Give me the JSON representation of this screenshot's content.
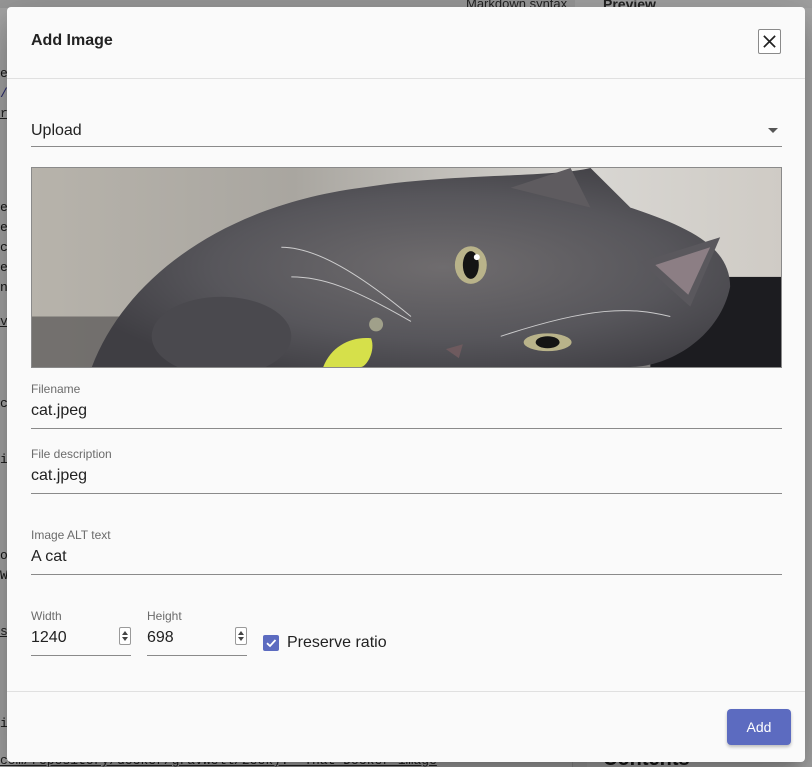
{
  "background": {
    "editor_syntax_label": "Markdown syntax",
    "preview_title": "Preview",
    "contents_heading": "Contents",
    "editor_line": "com/repository/docker/gravwell/zeek).  That Docker image"
  },
  "dialog": {
    "title": "Add Image",
    "close_icon": "close-icon",
    "source_select": {
      "value": "Upload",
      "options": [
        "Upload"
      ]
    },
    "image_preview": {
      "alt": "cat.jpeg"
    },
    "filename": {
      "label": "Filename",
      "value": "cat.jpeg"
    },
    "file_description": {
      "label": "File description",
      "value": "cat.jpeg"
    },
    "alt_text": {
      "label": "Image ALT text",
      "value": "A cat"
    },
    "width": {
      "label": "Width",
      "value": "1240"
    },
    "height": {
      "label": "Height",
      "value": "698"
    },
    "preserve_ratio": {
      "label": "Preserve ratio",
      "checked": true
    },
    "add_button": "Add"
  },
  "colors": {
    "accent": "#5c6bc0",
    "dialog_bg": "#fafafa",
    "border": "#8a8a8a"
  }
}
